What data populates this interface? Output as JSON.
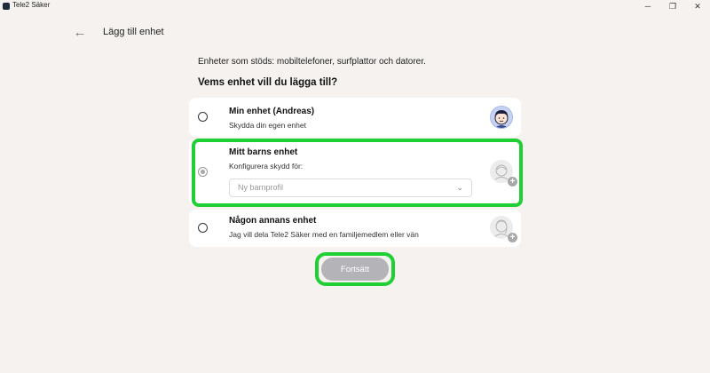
{
  "window": {
    "title": "Tele2 Säker",
    "minimize_glyph": "─",
    "maximize_glyph": "❐",
    "close_glyph": "✕"
  },
  "header": {
    "title": "Lägg till enhet",
    "back_glyph": "←"
  },
  "main": {
    "supported_text": "Enheter som stöds: mobiltelefoner, surfplattor och datorer.",
    "question": "Vems enhet vill du lägga till?",
    "options": [
      {
        "title": "Min enhet (Andreas)",
        "subtitle": "Skydda din egen enhet",
        "selected": false,
        "icon": "user-avatar-icon"
      },
      {
        "title": "Mitt barns enhet",
        "subtitle": "Konfigurera skydd för:",
        "selected": false,
        "disabled": true,
        "icon": "add-child-profile-icon",
        "select": {
          "placeholder": "Ny barnprofil",
          "chevron": "⌄"
        }
      },
      {
        "title": "Någon annans enhet",
        "subtitle": "Jag vill dela Tele2 Säker med en familjemedlem eller vän",
        "selected": false,
        "icon": "add-person-icon"
      }
    ],
    "continue_label": "Fortsätt"
  },
  "colors": {
    "highlight": "#1fd035",
    "button_disabled": "#b4b3b8",
    "background": "#f5f2ef"
  }
}
